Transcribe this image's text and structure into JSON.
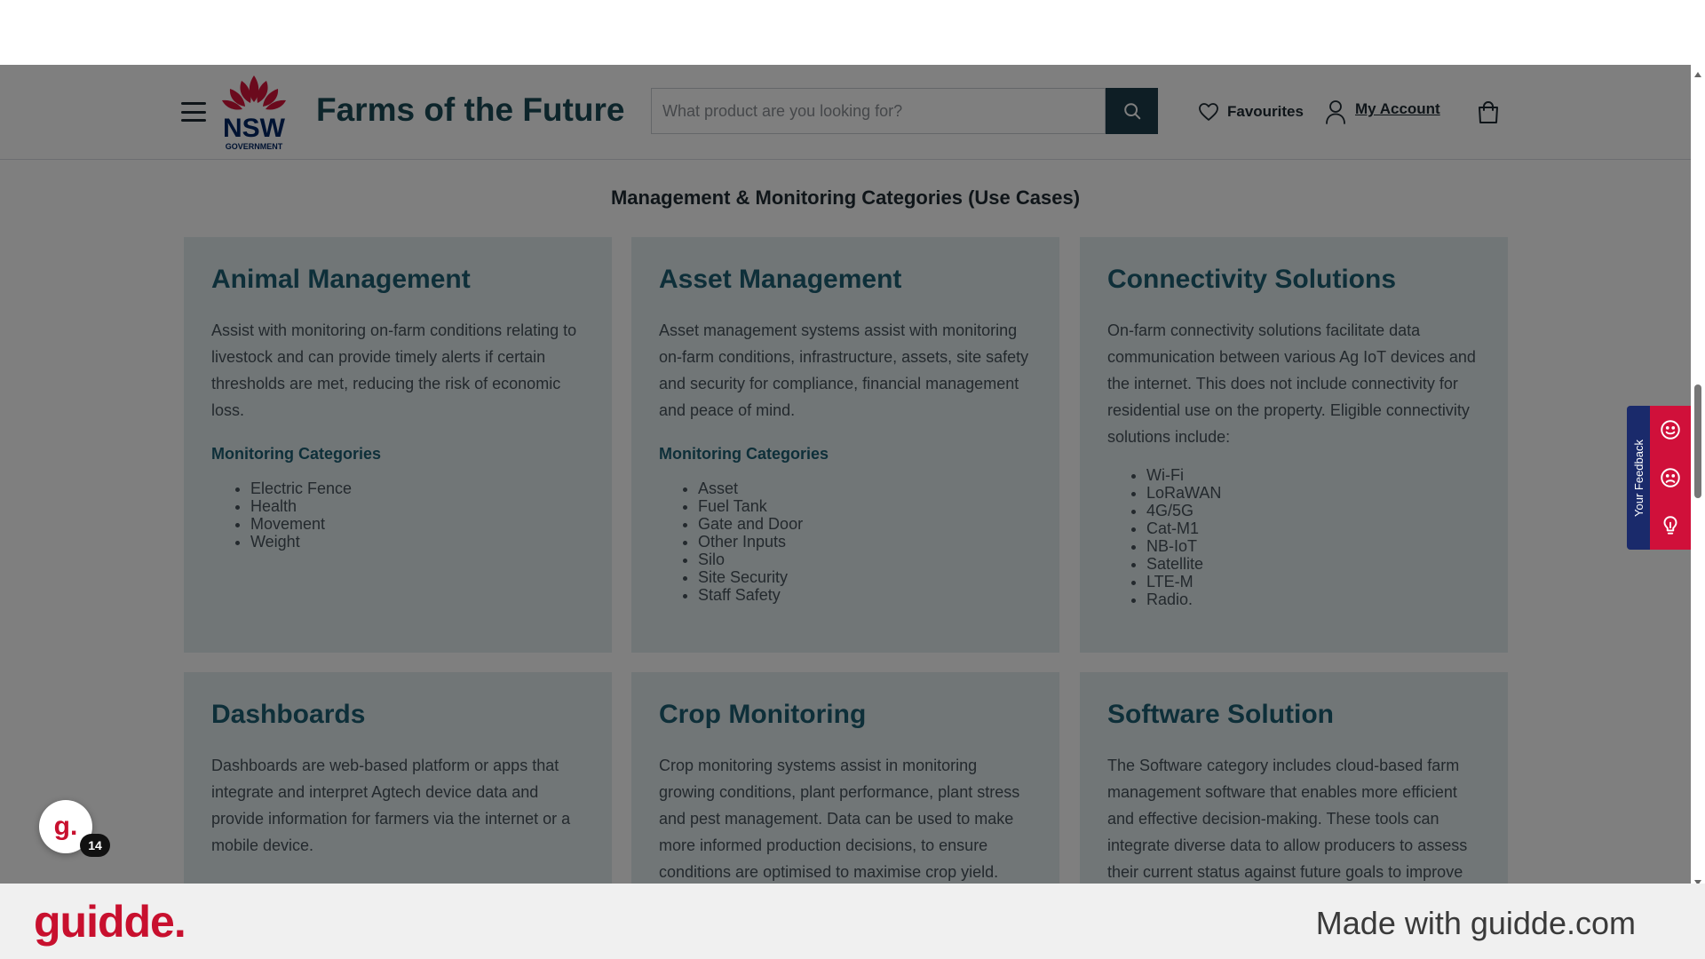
{
  "header": {
    "site_title": "Farms of the Future",
    "logo_text": "NSW",
    "logo_subtext": "GOVERNMENT",
    "search_placeholder": "What product are you looking for?",
    "favourites_label": "Favourites",
    "account_label": "My Account"
  },
  "section": {
    "heading": "Management & Monitoring Categories (Use Cases)"
  },
  "cards": [
    {
      "title": "Animal Management",
      "description": "Assist with monitoring on-farm conditions relating to livestock and can provide timely alerts if certain thresholds are met, reducing the risk of economic loss.",
      "subheading": "Monitoring Categories",
      "items": [
        "Electric Fence",
        "Health",
        "Movement",
        "Weight"
      ]
    },
    {
      "title": "Asset Management",
      "description": "Asset management systems assist with monitoring on-farm conditions, infrastructure, assets, site safety and security for compliance, financial management and peace of mind.",
      "subheading": "Monitoring Categories",
      "items": [
        "Asset",
        "Fuel Tank",
        "Gate and Door",
        "Other Inputs",
        "Silo",
        "Site Security",
        "Staff Safety"
      ]
    },
    {
      "title": "Connectivity Solutions",
      "description": "On-farm connectivity solutions facilitate data communication between various Ag IoT devices and the internet. This does not include connectivity for residential use on the property. Eligible connectivity solutions include:",
      "items": [
        "Wi-Fi",
        "LoRaWAN",
        "4G/5G",
        "Cat-M1",
        "NB-IoT",
        "Satellite",
        "LTE-M",
        "Radio."
      ]
    },
    {
      "title": "Dashboards",
      "description": "Dashboards are web-based platform or apps that integrate and interpret Agtech device data and provide information for farmers via the internet or a mobile device."
    },
    {
      "title": "Crop Monitoring",
      "description": "Crop monitoring systems assist in monitoring growing conditions, plant performance, plant stress and pest management. Data can be used to make more informed production decisions, to ensure conditions are optimised to maximise crop yield."
    },
    {
      "title": "Software Solution",
      "description": "The Software category includes cloud-based farm management software that enables more efficient and effective decision-making. These tools can integrate diverse data to allow producers to assess their current status against future goals to improve"
    }
  ],
  "feedback": {
    "label": "Your Feedback"
  },
  "guidde": {
    "avatar_text": "g.",
    "badge_count": "14",
    "footer_logo": "guidde.",
    "footer_tagline": "Made with guidde.com"
  },
  "colors": {
    "title_teal": "#1b4a57",
    "card_heading": "#1c5f73",
    "card_bg": "#e3ecef",
    "search_button": "#1c3d4b",
    "feedback_navy": "#1a2a6b",
    "feedback_red": "#d0103a",
    "guidde_red": "#c8102e"
  },
  "icons": {
    "menu": "hamburger-menu-icon",
    "search": "search-icon",
    "favourites": "heart-icon",
    "account": "user-icon",
    "cart": "shopping-bag-icon",
    "feedback_positive": "smile-icon",
    "feedback_negative": "frown-icon",
    "feedback_idea": "lightbulb-icon"
  }
}
